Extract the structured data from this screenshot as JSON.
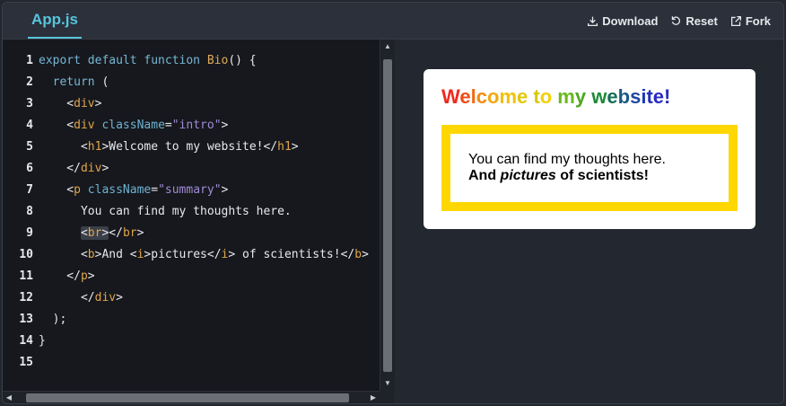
{
  "tab": {
    "label": "App.js"
  },
  "toolbar": {
    "download_label": "Download",
    "reset_label": "Reset",
    "fork_label": "Fork"
  },
  "code": {
    "line_numbers": [
      "1",
      "2",
      "3",
      "4",
      "5",
      "6",
      "7",
      "8",
      "9",
      "10",
      "11",
      "12",
      "13",
      "14",
      "15"
    ]
  },
  "preview": {
    "heading": [
      "W",
      "e",
      "l",
      "c",
      "o",
      "m",
      "e",
      " ",
      "t",
      "o",
      " ",
      "m",
      "y",
      " ",
      "w",
      "e",
      "b",
      "s",
      "i",
      "t",
      "e",
      "!"
    ],
    "heading_colors": [
      "#f0281e",
      "#f04a14",
      "#f16a12",
      "#f28a10",
      "#f2a80e",
      "#f2c00c",
      "#e0c80a",
      "#c8cc08",
      "#d8c80a",
      "#f2d00a",
      "#9ac81a",
      "#6ab81e",
      "#4ca820",
      "#2a9a24",
      "#1a8a34",
      "#166e5a",
      "#1a5a84",
      "#1c48a4",
      "#1e38b4",
      "#2230bc",
      "#2a2ac0",
      "#2a2ac0"
    ],
    "line1": "You can find my thoughts here.",
    "line2_before": "And ",
    "line2_italic": "pictures",
    "line2_after": " of scientists!"
  }
}
